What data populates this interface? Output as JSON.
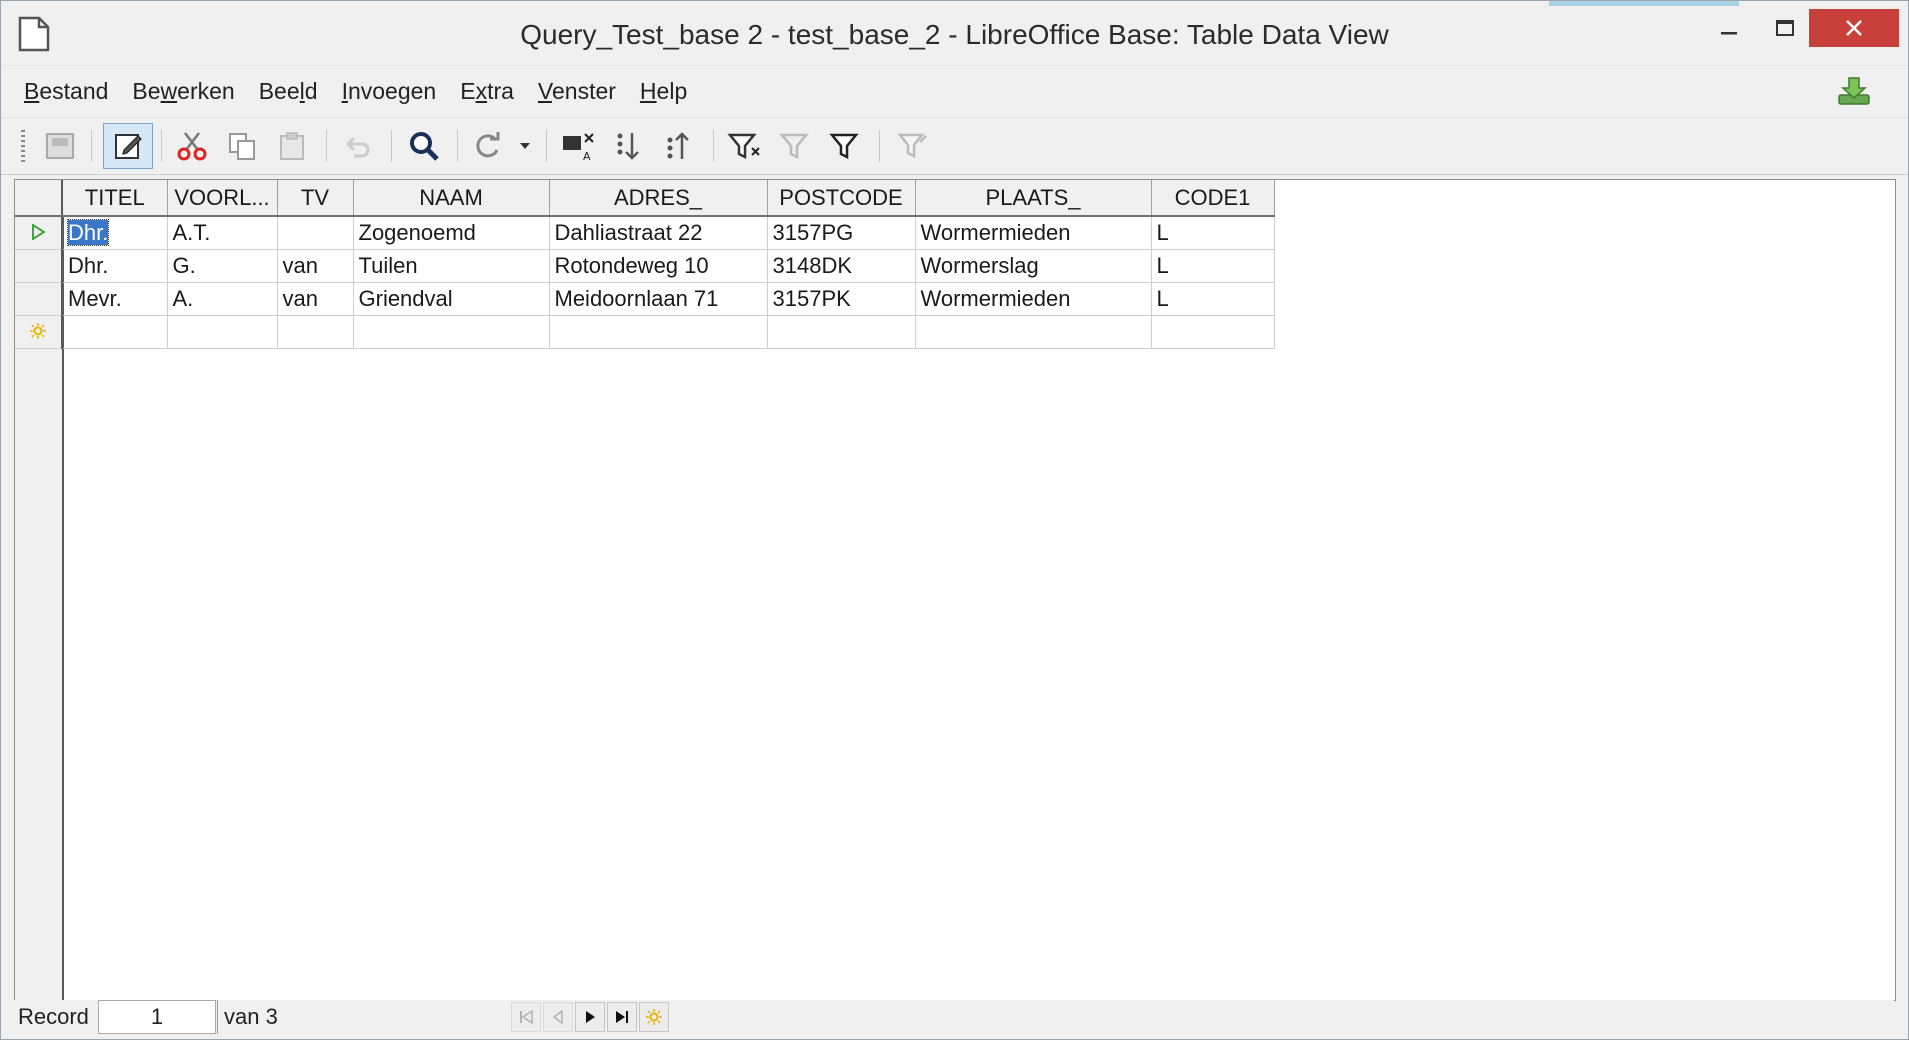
{
  "window": {
    "title": "Query_Test_base 2 - test_base_2 - LibreOffice Base: Table Data View"
  },
  "menu": [
    {
      "pre": "",
      "mnem": "B",
      "post": "estand"
    },
    {
      "pre": "Be",
      "mnem": "w",
      "post": "erken"
    },
    {
      "pre": "Bee",
      "mnem": "l",
      "post": "d"
    },
    {
      "pre": "",
      "mnem": "I",
      "post": "nvoegen"
    },
    {
      "pre": "E",
      "mnem": "x",
      "post": "tra"
    },
    {
      "pre": "",
      "mnem": "V",
      "post": "enster"
    },
    {
      "pre": "",
      "mnem": "H",
      "post": "elp"
    }
  ],
  "toolbar": {
    "icons": [
      "save-record-icon",
      "edit-data-icon",
      "cut-icon",
      "copy-icon",
      "paste-icon",
      "undo-icon",
      "find-record-icon",
      "refresh-icon",
      "sort-icon",
      "sort-ascending-icon",
      "sort-descending-icon",
      "autofilter-icon",
      "apply-filter-icon",
      "standard-filter-icon",
      "reset-filter-icon"
    ]
  },
  "grid": {
    "columns": [
      "TITEL",
      "VOORL...",
      "TV",
      "NAAM",
      "ADRES_",
      "POSTCODE",
      "PLAATS_",
      "CODE1"
    ],
    "rows": [
      [
        "Dhr.",
        "A.T.",
        "",
        "Zogenoemd",
        "Dahliastraat 22",
        "3157PG",
        "Wormermieden",
        "L"
      ],
      [
        "Dhr.",
        "G.",
        "van",
        "Tuilen",
        "Rotondeweg 10",
        "3148DK",
        "Wormerslag",
        "L"
      ],
      [
        "Mevr.",
        "A.",
        "van",
        "Griendval",
        "Meidoornlaan 71",
        "3157PK",
        "Wormermieden",
        "L"
      ]
    ]
  },
  "status": {
    "record_label": "Record",
    "record_number": "1",
    "of_text": "van 3"
  },
  "colors": {
    "close_button": "#c9403a",
    "selection": "#3b77c9",
    "current_row_marker": "#3aa53a",
    "new_row_marker": "#e8b400"
  }
}
